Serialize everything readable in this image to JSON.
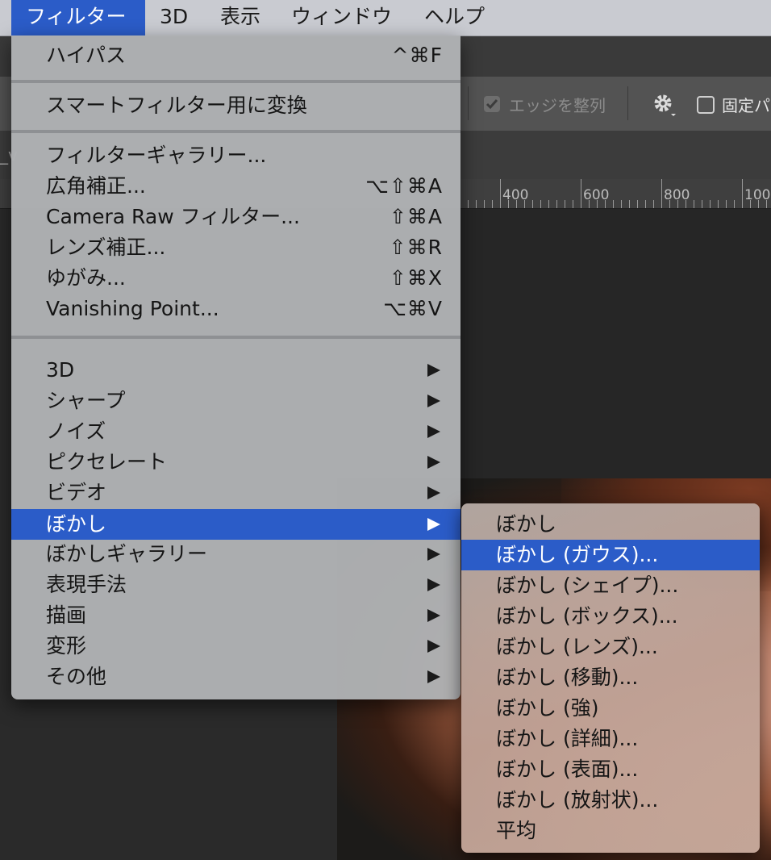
{
  "menubar": {
    "items": [
      {
        "label": "フィルター",
        "active": true
      },
      {
        "label": "3D"
      },
      {
        "label": "表示"
      },
      {
        "label": "ウィンドウ"
      },
      {
        "label": "ヘルプ"
      }
    ]
  },
  "options_bar": {
    "align_edge_label": "エッジを整列",
    "fixed_label": "固定パ"
  },
  "ruler": {
    "labels": [
      "400",
      "600",
      "800",
      "100"
    ]
  },
  "filter_menu": {
    "last_filter": {
      "label": "ハイパス",
      "shortcut": "^⌘F"
    },
    "smart": {
      "label": "スマートフィルター用に変換"
    },
    "group1": [
      {
        "label": "フィルターギャラリー...",
        "shortcut": ""
      },
      {
        "label": "広角補正...",
        "shortcut": "⌥⇧⌘A"
      },
      {
        "label": "Camera Raw フィルター...",
        "shortcut": "⇧⌘A"
      },
      {
        "label": "レンズ補正...",
        "shortcut": "⇧⌘R"
      },
      {
        "label": "ゆがみ...",
        "shortcut": "⇧⌘X"
      },
      {
        "label": "Vanishing Point...",
        "shortcut": "⌥⌘V"
      }
    ],
    "group2": [
      {
        "label": "3D"
      },
      {
        "label": "シャープ"
      },
      {
        "label": "ノイズ"
      },
      {
        "label": "ピクセレート"
      },
      {
        "label": "ビデオ"
      },
      {
        "label": "ぼかし"
      },
      {
        "label": "ぼかしギャラリー"
      },
      {
        "label": "表現手法"
      },
      {
        "label": "描画"
      },
      {
        "label": "変形"
      },
      {
        "label": "その他"
      }
    ]
  },
  "blur_submenu": {
    "items": [
      {
        "label": "ぼかし"
      },
      {
        "label": "ぼかし (ガウス)..."
      },
      {
        "label": "ぼかし (シェイプ)..."
      },
      {
        "label": "ぼかし (ボックス)..."
      },
      {
        "label": "ぼかし (レンズ)..."
      },
      {
        "label": "ぼかし (移動)..."
      },
      {
        "label": "ぼかし (強)"
      },
      {
        "label": "ぼかし (詳細)..."
      },
      {
        "label": "ぼかし (表面)..."
      },
      {
        "label": "ぼかし (放射状)..."
      },
      {
        "label": "平均"
      }
    ]
  },
  "colors": {
    "highlight": "#2b5cc8",
    "menubar": "#c9cbd1",
    "menu_bg": "#b0b2b4"
  }
}
